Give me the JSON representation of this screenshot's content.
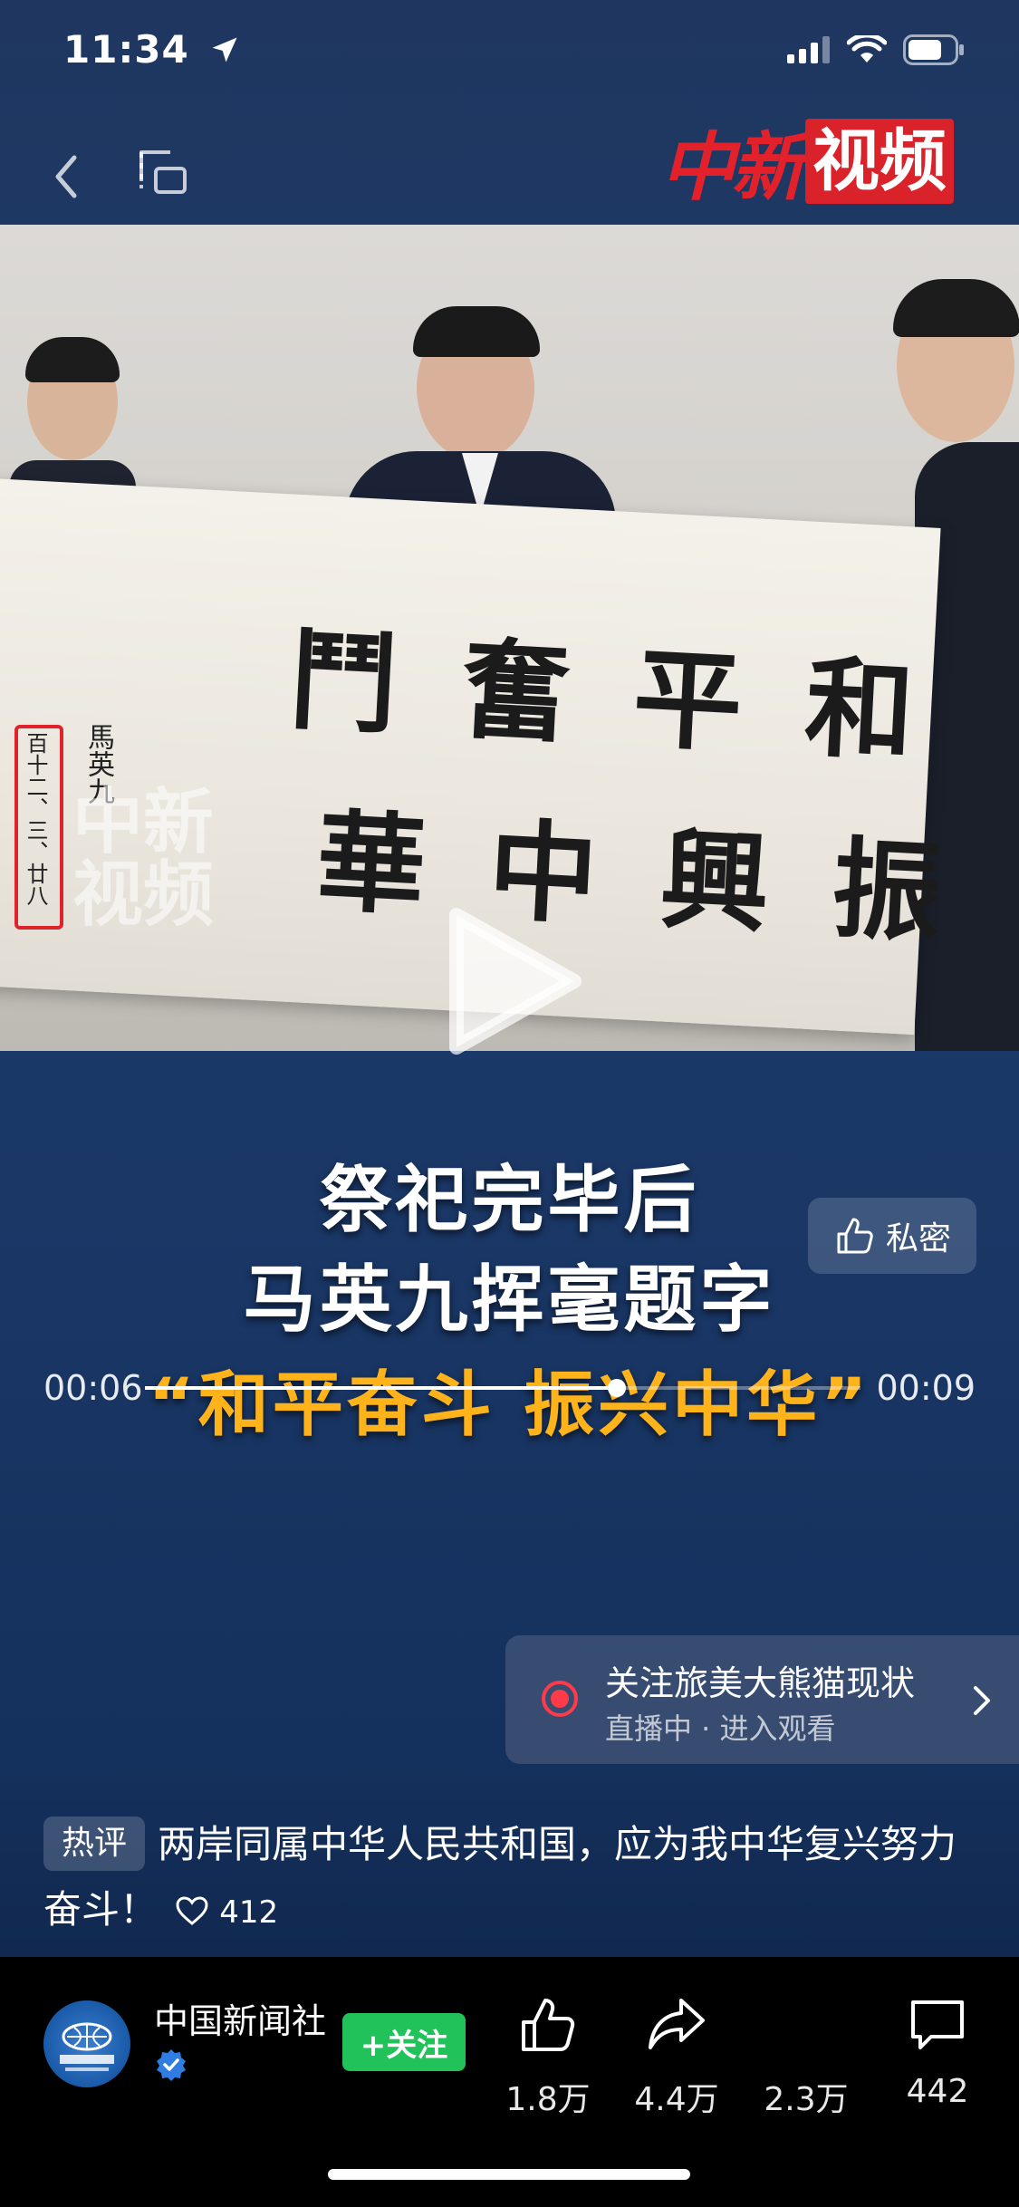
{
  "status_bar": {
    "time": "11:34"
  },
  "header": {
    "brand_logo_red": "中新",
    "brand_logo_box": "视频"
  },
  "video": {
    "calligraphy_line1": "和平奮鬥",
    "calligraphy_line2": "振興中華",
    "signature": "馬英九",
    "date_inscription": "百十二、三、廿八",
    "watermark_line1": "中新",
    "watermark_line2": "视频",
    "progress": 0.66
  },
  "caption": {
    "line1": "祭祀完毕后",
    "line2": "马英九挥毫题字",
    "line3": "“和平奋斗 振兴中华”"
  },
  "player": {
    "current_time": "00:06",
    "total_time": "00:09"
  },
  "private_pill": {
    "label": "私密"
  },
  "live_card": {
    "title": "关注旅美大熊猫现状",
    "subtitle": "直播中 · 进入观看"
  },
  "hot_comment": {
    "tag": "热评",
    "text": "两岸同属中华人民共和国，应为我中华复兴努力奋斗！",
    "likes": "412"
  },
  "account": {
    "name": "中国新闻社",
    "follow_label": "+关注"
  },
  "actions": {
    "like_count": "1.8万",
    "share_count": "4.4万",
    "collect_count": "2.3万",
    "comment_count": "442"
  }
}
